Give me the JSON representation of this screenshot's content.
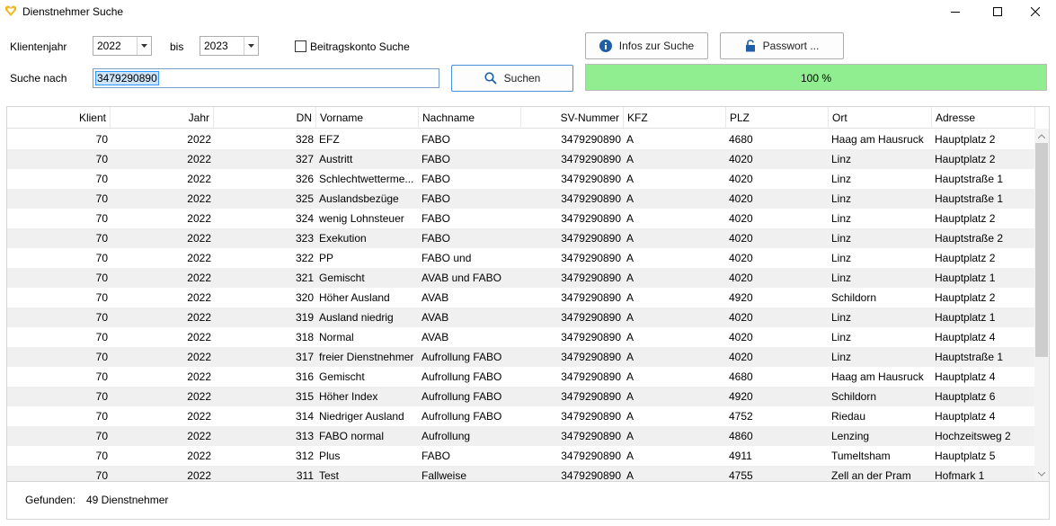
{
  "window": {
    "title": "Dienstnehmer Suche",
    "minimize_icon": "minimize-icon",
    "maximize_icon": "maximize-icon",
    "close_icon": "close-icon"
  },
  "filters": {
    "klientenjahr_label": "Klientenjahr",
    "year_from": "2022",
    "bis_label": "bis",
    "year_to": "2023",
    "beitragskonto_label": "Beitragskonto Suche",
    "beitragskonto_checked": false,
    "suche_nach_label": "Suche nach",
    "search_value": "3479290890"
  },
  "buttons": {
    "infos_label": "Infos zur Suche",
    "passwort_label": "Passwort ...",
    "suchen_label": "Suchen"
  },
  "progress": {
    "value": 100,
    "text": "100 %",
    "color": "#90ee90"
  },
  "table": {
    "columns": [
      "Klient",
      "Jahr",
      "DN",
      "Vorname",
      "Nachname",
      "SV-Nummer",
      "KFZ",
      "PLZ",
      "Ort",
      "Adresse"
    ],
    "rows": [
      [
        "70",
        "2022",
        "328",
        "EFZ",
        "FABO",
        "3479290890",
        "A",
        "4680",
        "Haag am Hausruck",
        "Hauptplatz 2"
      ],
      [
        "70",
        "2022",
        "327",
        "Austritt",
        "FABO",
        "3479290890",
        "A",
        "4020",
        "Linz",
        "Hauptplatz 2"
      ],
      [
        "70",
        "2022",
        "326",
        "Schlechtwetterme...",
        "FABO",
        "3479290890",
        "A",
        "4020",
        "Linz",
        "Hauptstraße 1"
      ],
      [
        "70",
        "2022",
        "325",
        "Auslandsbezüge",
        "FABO",
        "3479290890",
        "A",
        "4020",
        "Linz",
        "Hauptstraße 1"
      ],
      [
        "70",
        "2022",
        "324",
        "wenig Lohnsteuer",
        "FABO",
        "3479290890",
        "A",
        "4020",
        "Linz",
        "Hauptplatz 2"
      ],
      [
        "70",
        "2022",
        "323",
        "Exekution",
        "FABO",
        "3479290890",
        "A",
        "4020",
        "Linz",
        "Hauptstraße 2"
      ],
      [
        "70",
        "2022",
        "322",
        "PP",
        "FABO und",
        "3479290890",
        "A",
        "4020",
        "Linz",
        "Hauptplatz 2"
      ],
      [
        "70",
        "2022",
        "321",
        "Gemischt",
        "AVAB und FABO",
        "3479290890",
        "A",
        "4020",
        "Linz",
        "Hauptplatz 1"
      ],
      [
        "70",
        "2022",
        "320",
        "Höher Ausland",
        "AVAB",
        "3479290890",
        "A",
        "4920",
        "Schildorn",
        "Hauptplatz 2"
      ],
      [
        "70",
        "2022",
        "319",
        "Ausland niedrig",
        "AVAB",
        "3479290890",
        "A",
        "4020",
        "Linz",
        "Hauptplatz 1"
      ],
      [
        "70",
        "2022",
        "318",
        "Normal",
        "AVAB",
        "3479290890",
        "A",
        "4020",
        "Linz",
        "Hauptplatz 4"
      ],
      [
        "70",
        "2022",
        "317",
        "freier Dienstnehmer",
        "Aufrollung FABO",
        "3479290890",
        "A",
        "4020",
        "Linz",
        "Hauptstraße 1"
      ],
      [
        "70",
        "2022",
        "316",
        "Gemischt",
        "Aufrollung FABO",
        "3479290890",
        "A",
        "4680",
        "Haag am Hausruck",
        "Hauptplatz 4"
      ],
      [
        "70",
        "2022",
        "315",
        "Höher Index",
        "Aufrollung FABO",
        "3479290890",
        "A",
        "4920",
        "Schildorn",
        "Hauptplatz 6"
      ],
      [
        "70",
        "2022",
        "314",
        "Niedriger Ausland",
        "Aufrollung FABO",
        "3479290890",
        "A",
        "4752",
        "Riedau",
        "Hauptplatz 4"
      ],
      [
        "70",
        "2022",
        "313",
        "FABO normal",
        "Aufrollung",
        "3479290890",
        "A",
        "4860",
        "Lenzing",
        "Hochzeitsweg 2"
      ],
      [
        "70",
        "2022",
        "312",
        "Plus",
        "FABO",
        "3479290890",
        "A",
        "4911",
        "Tumeltsham",
        "Hauptplatz 5"
      ],
      [
        "70",
        "2022",
        "311",
        "Test",
        "Fallweise",
        "3479290890",
        "A",
        "4755",
        "Zell an der Pram",
        "Hofmark 1"
      ]
    ]
  },
  "footer": {
    "gefunden_label": "Gefunden:",
    "gefunden_value": "49 Dienstnehmer"
  }
}
